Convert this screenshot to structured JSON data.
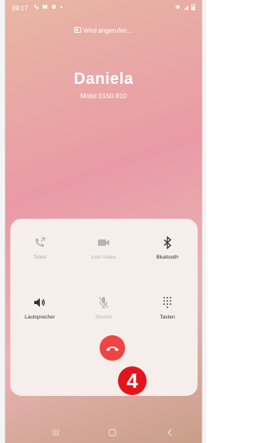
{
  "status": {
    "time": "09:17"
  },
  "call": {
    "status_text": "Wird angerufen…",
    "caller_name": "Daniela",
    "caller_number": "Mobil 0160 810"
  },
  "controls": {
    "share": "Teilen",
    "video": "Live-Video",
    "bluetooth": "Bluetooth",
    "speaker": "Lautsprecher",
    "mute": "Stumm",
    "keypad": "Tasten"
  },
  "badge": {
    "number": "4"
  },
  "icons": {
    "share": "share-call-icon",
    "video": "video-camera-icon",
    "bluetooth": "bluetooth-icon",
    "speaker": "speaker-icon",
    "mute": "microphone-muted-icon",
    "keypad": "keypad-icon",
    "end": "end-call-icon"
  },
  "colors": {
    "end_call": "#ee4444",
    "badge": "#e4141c"
  }
}
